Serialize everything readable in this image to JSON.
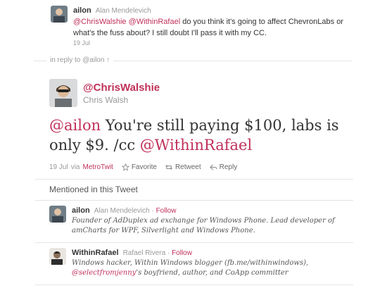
{
  "previous_tweet": {
    "username": "ailon",
    "realname": "Alan Mendelevich",
    "mention1": "@ChrisWalshie",
    "mention2": "@WithinRafael",
    "text": " do you think it's going to affect ChevronLabs or what's the fuss about? I still doubt I'll pass it with my CC.",
    "time": "19 Jul"
  },
  "in_reply_to": "in reply to @ailon ↑",
  "main_tweet": {
    "handle": "@ChrisWalshie",
    "name": "Chris Walsh",
    "mention_start": "@ailon",
    "text_middle": " You're still paying $100, labs is only $9. /cc ",
    "mention_end": "@WithinRafael",
    "time": "19 Jul",
    "via_label": "via",
    "via_app": "MetroTwit",
    "favorite_label": "Favorite",
    "retweet_label": "Retweet",
    "reply_label": "Reply"
  },
  "mentioned": {
    "title": "Mentioned in this Tweet",
    "users": [
      {
        "username": "ailon",
        "realname": "Alan Mendelevich",
        "follow_label": "Follow",
        "bio": "Founder of AdDuplex ad exchange for Windows Phone. Lead developer of amCharts for WPF, Silverlight and Windows Phone."
      },
      {
        "username": "WithinRafael",
        "realname": "Rafael Rivera",
        "follow_label": "Follow",
        "bio_line1": "Windows hacker, Within Windows blogger (fb.me/withinwindows),",
        "bio_mention": "@selectfromjenny",
        "bio_line2": "'s boyfriend, author, and CoApp committer"
      }
    ]
  },
  "colors": {
    "link": "#c0305a",
    "muted": "#999999"
  }
}
